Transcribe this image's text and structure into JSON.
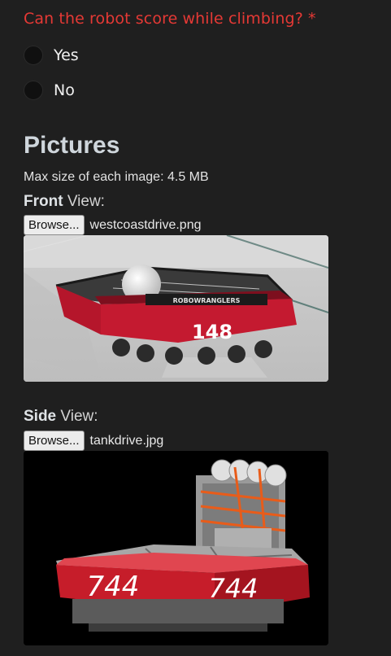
{
  "question": {
    "label": "Can the robot score while climbing? *",
    "color": "#e53935",
    "options": [
      {
        "label": "Yes"
      },
      {
        "label": "No"
      }
    ]
  },
  "pictures": {
    "title": "Pictures",
    "max_size": "Max size of each image: 4.5 MB",
    "front": {
      "bold": "Front",
      "rest": " View:",
      "browse_label": "Browse...",
      "file_name": "westcoastdrive.png",
      "robot_number": "148"
    },
    "side": {
      "bold": "Side",
      "rest": " View:",
      "browse_label": "Browse...",
      "file_name": "tankdrive.jpg",
      "robot_number": "744"
    }
  }
}
